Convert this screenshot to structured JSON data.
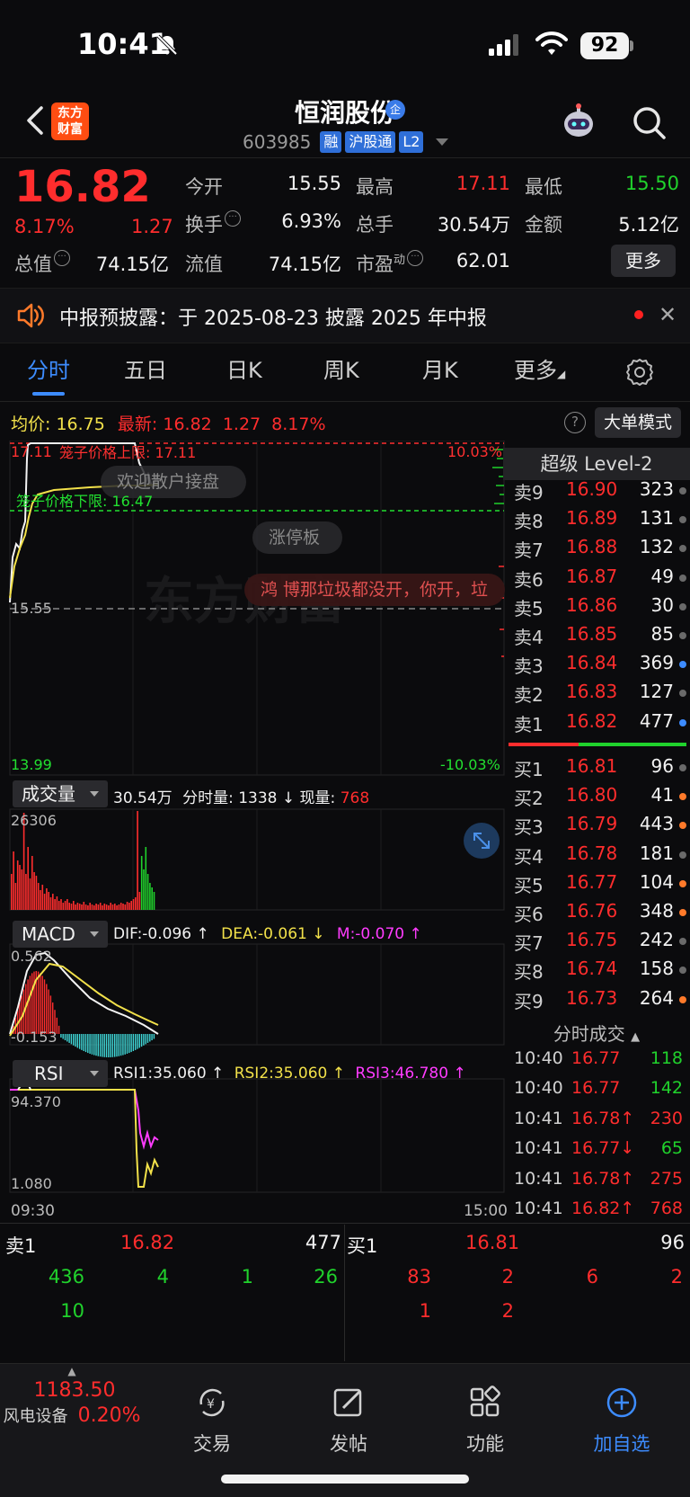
{
  "status": {
    "time": "10:41",
    "battery": "92"
  },
  "header": {
    "logo_line1": "东方",
    "logo_line2": "财富",
    "name": "恒润股份",
    "corp_badge": "企",
    "code": "603985",
    "tags": [
      "融",
      "沪股通",
      "L2"
    ]
  },
  "quote": {
    "price": "16.82",
    "pct": "8.17%",
    "change": "1.27",
    "open_label": "今开",
    "open": "15.55",
    "high_label": "最高",
    "high": "17.11",
    "low_label": "最低",
    "low": "15.50",
    "turnover_label": "换手",
    "turnover": "6.93%",
    "volume_label": "总手",
    "volume": "30.54万",
    "amount_label": "金额",
    "amount": "5.12亿",
    "mcap_label": "总值",
    "mcap": "74.15亿",
    "float_label": "流值",
    "float": "74.15亿",
    "pe_label": "市盈",
    "pe_sup": "动",
    "pe": "62.01",
    "more_label": "更多"
  },
  "notice": {
    "text": "中报预披露：于 2025-08-23 披露 2025 年中报"
  },
  "tabs": [
    "分时",
    "五日",
    "日K",
    "周K",
    "月K",
    "更多"
  ],
  "chart_header": {
    "avg_label": "均价:",
    "avg": "16.75",
    "last_label": "最新:",
    "last": "16.82",
    "change": "1.27",
    "pct": "8.17%",
    "help": "?",
    "big_order_btn": "大单模式"
  },
  "chart_labels": {
    "upper_price": "17.11",
    "upper_pct": "10.03%",
    "cage_upper": "笼子价格上限: 17.11",
    "cage_lower": "笼子价格下限: 16.47",
    "open_price": "15.55",
    "lower_price": "13.99",
    "lower_pct": "-10.03%",
    "bubble_welcome": "欢迎散户接盘",
    "bubble_limit": "涨停板",
    "danmaku": "鸿 博那垃圾都没开，你开，垃",
    "watermark": "东方财富"
  },
  "volume_panel": {
    "label": "成交量",
    "total": "30.54万",
    "minute_label": "分时量:",
    "minute": "1338",
    "current_label": "现量:",
    "current": "768",
    "max": "26306"
  },
  "macd_panel": {
    "label": "MACD",
    "dif": "DIF:-0.096 ↑",
    "dea": "DEA:-0.061 ↓",
    "m": "M:-0.070 ↑",
    "top": "0.562",
    "bottom": "-0.153"
  },
  "rsi_panel": {
    "label": "RSI",
    "rsi1": "RSI1:35.060 ↑",
    "rsi2": "RSI2:35.060 ↑",
    "rsi3": "RSI3:46.780 ↑",
    "top": "94.370",
    "bottom": "1.080"
  },
  "time_axis": {
    "start": "09:30",
    "end": "15:00"
  },
  "level2": {
    "title": "超级 Level-2",
    "asks": [
      {
        "label": "卖9",
        "price": "16.90",
        "vol": "323",
        "dot": "#6a6a6a"
      },
      {
        "label": "卖8",
        "price": "16.89",
        "vol": "131",
        "dot": "#6a6a6a"
      },
      {
        "label": "卖7",
        "price": "16.88",
        "vol": "132",
        "dot": "#6a6a6a"
      },
      {
        "label": "卖6",
        "price": "16.87",
        "vol": "49",
        "dot": "#6a6a6a"
      },
      {
        "label": "卖5",
        "price": "16.86",
        "vol": "30",
        "dot": "#6a6a6a"
      },
      {
        "label": "卖4",
        "price": "16.85",
        "vol": "85",
        "dot": "#6a6a6a"
      },
      {
        "label": "卖3",
        "price": "16.84",
        "vol": "369",
        "dot": "#3d8cff"
      },
      {
        "label": "卖2",
        "price": "16.83",
        "vol": "127",
        "dot": "#6a6a6a"
      },
      {
        "label": "卖1",
        "price": "16.82",
        "vol": "477",
        "dot": "#3d8cff"
      }
    ],
    "bids": [
      {
        "label": "买1",
        "price": "16.81",
        "vol": "96",
        "dot": "#6a6a6a"
      },
      {
        "label": "买2",
        "price": "16.80",
        "vol": "41",
        "dot": "#ff7a2a"
      },
      {
        "label": "买3",
        "price": "16.79",
        "vol": "443",
        "dot": "#ff7a2a"
      },
      {
        "label": "买4",
        "price": "16.78",
        "vol": "181",
        "dot": "#6a6a6a"
      },
      {
        "label": "买5",
        "price": "16.77",
        "vol": "104",
        "dot": "#ff7a2a"
      },
      {
        "label": "买6",
        "price": "16.76",
        "vol": "348",
        "dot": "#ff7a2a"
      },
      {
        "label": "买7",
        "price": "16.75",
        "vol": "242",
        "dot": "#6a6a6a"
      },
      {
        "label": "买8",
        "price": "16.74",
        "vol": "158",
        "dot": "#6a6a6a"
      },
      {
        "label": "买9",
        "price": "16.73",
        "vol": "264",
        "dot": "#ff7a2a"
      }
    ],
    "ticks_title": "分时成交",
    "ticks": [
      {
        "time": "10:40",
        "price": "16.77",
        "vol": "118",
        "color": "#20d22c"
      },
      {
        "time": "10:40",
        "price": "16.77",
        "vol": "142",
        "color": "#20d22c"
      },
      {
        "time": "10:41",
        "price": "16.78↑",
        "vol": "230",
        "color": "#ff2d2d"
      },
      {
        "time": "10:41",
        "price": "16.77↓",
        "vol": "65",
        "color": "#20d22c"
      },
      {
        "time": "10:41",
        "price": "16.78↑",
        "vol": "275",
        "color": "#ff2d2d"
      },
      {
        "time": "10:41",
        "price": "16.82↑",
        "vol": "768",
        "color": "#ff2d2d"
      }
    ]
  },
  "summary": {
    "ask_label": "卖1",
    "ask_price": "16.82",
    "ask_vol": "477",
    "bid_label": "买1",
    "bid_price": "16.81",
    "bid_vol": "96",
    "ask_queue_row1": [
      "436",
      "4",
      "1",
      "26"
    ],
    "ask_queue_row2": [
      "10"
    ],
    "bid_queue_row1": [
      "83",
      "2",
      "6",
      "2"
    ],
    "bid_queue_row2": [
      "1",
      "2"
    ]
  },
  "bottom_nav": {
    "index_value": "1183.50",
    "index_name": "风电设备",
    "index_pct": "0.20%",
    "items": [
      "交易",
      "发帖",
      "功能",
      "加自选"
    ]
  },
  "colors": {
    "up": "#ff2d2d",
    "down": "#20d22c",
    "accent": "#3d8cff",
    "yellow": "#f2e14a"
  }
}
